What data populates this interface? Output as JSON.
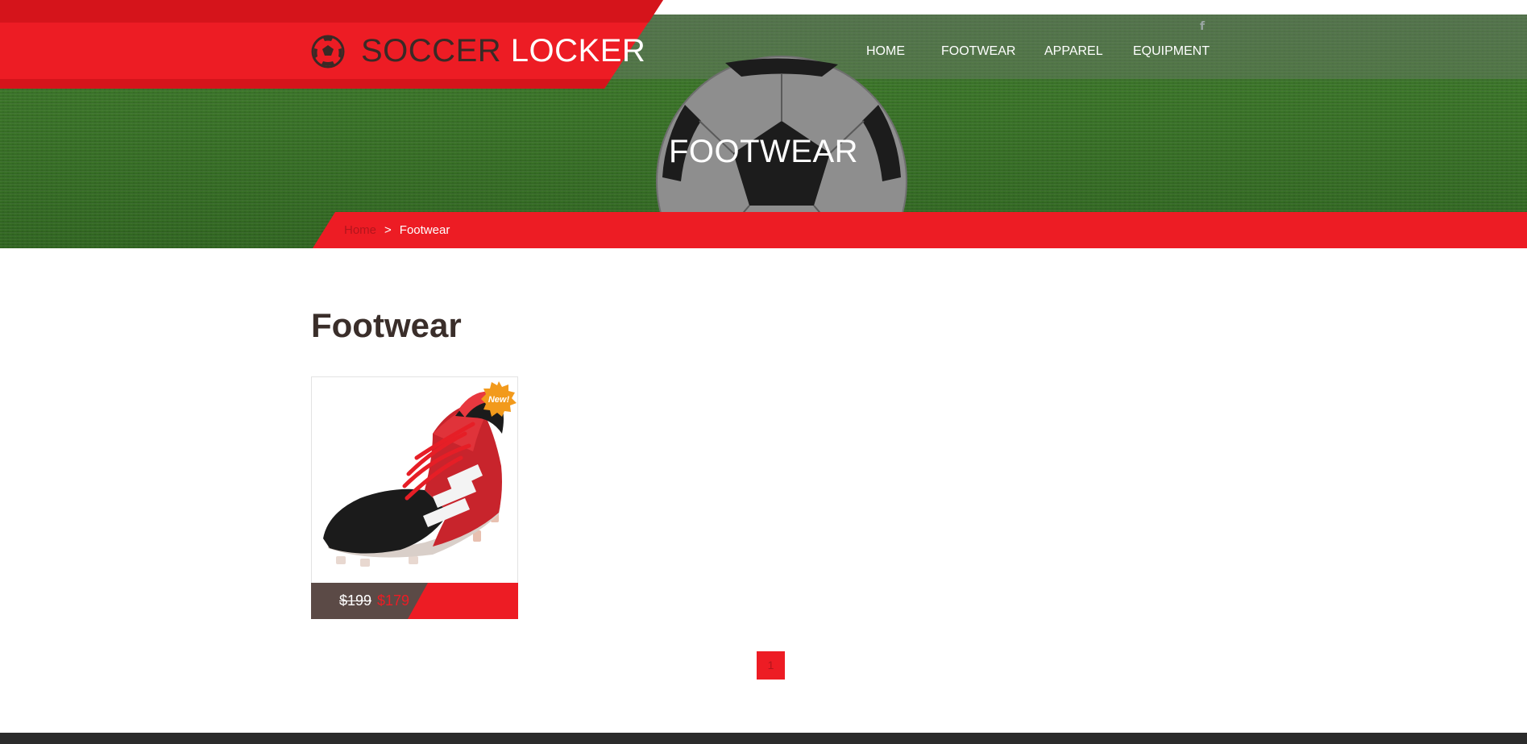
{
  "brand": {
    "name_part1": "SOCCER",
    "name_part2": "LOCKER"
  },
  "social": {
    "facebook_glyph": "f"
  },
  "nav": {
    "items": [
      {
        "label": "HOME"
      },
      {
        "label": "FOOTWEAR"
      },
      {
        "label": "APPAREL"
      },
      {
        "label": "EQUIPMENT"
      }
    ]
  },
  "hero": {
    "title": "FOOTWEAR"
  },
  "breadcrumb": {
    "home": "Home",
    "separator": ">",
    "current": "Footwear"
  },
  "main": {
    "heading": "Footwear",
    "products": [
      {
        "badge": "New!",
        "price_old": "$199",
        "price_new": "$179",
        "image_icon": "soccer-cleat-image"
      }
    ],
    "pagination": {
      "current_page": "1"
    }
  },
  "colors": {
    "brand_red": "#ed1c24",
    "brand_dark_red": "#d5141b",
    "brown": "#5b4a46",
    "text_dark": "#3a2e2a",
    "badge_orange": "#f29a1c"
  }
}
